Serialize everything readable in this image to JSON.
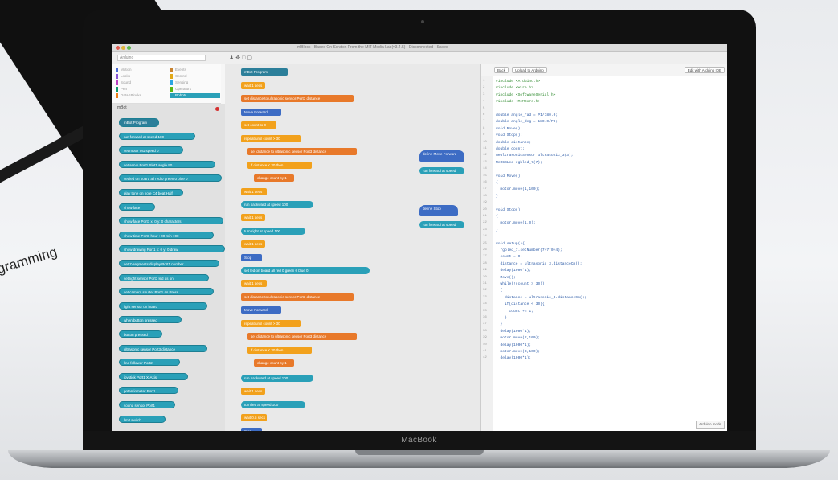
{
  "backdrop": {
    "caption": "gramming"
  },
  "laptop": {
    "brand": "MacBook"
  },
  "window": {
    "title": "mBlock - Based On Scratch From the MIT Media Lab(v3.4.5) - Disconnected - Saved",
    "search_placeholder": "Arduino"
  },
  "categories": [
    {
      "label": "Motion",
      "color": "#4a6cd4"
    },
    {
      "label": "Looks",
      "color": "#8a55d7"
    },
    {
      "label": "Sound",
      "color": "#bb42c3"
    },
    {
      "label": "Pen",
      "color": "#0e9a6c"
    },
    {
      "label": "Data&Blocks",
      "color": "#ee7d16"
    },
    {
      "label": "Events",
      "color": "#c88330"
    },
    {
      "label": "Control",
      "color": "#e1a91a"
    },
    {
      "label": "Sensing",
      "color": "#2ca5e2"
    },
    {
      "label": "Operators",
      "color": "#5cb712"
    },
    {
      "label": "Robots",
      "color": "#2aa0b8"
    }
  ],
  "flyout": {
    "title": "mBot",
    "blocks": [
      "mBot Program",
      "run forward at speed 100",
      "set motor M1 speed 0",
      "set servo Port1 Slot1 angle 90",
      "set led on board all red 0 green 0 blue 0",
      "play tone on note C4 beat Half",
      "show face",
      "show face Port1 x: 0 y: 0 characters",
      "show time Port1 hour : 00 min : 00",
      "show drawing Port1 x: 0 y: 0 draw",
      "set 7-segments display Port1 number",
      "set light sensor Port3 led as on",
      "set camera shutter Port1 as Press",
      "light sensor on board",
      "when button pressed",
      "button pressed",
      "ultrasonic sensor Port3 distance",
      "line follower Port2",
      "joystick Port1 X-Axis",
      "potentiometer Port1",
      "sound sensor Port1",
      "limit switch"
    ]
  },
  "workspace": {
    "blocks": [
      "mBot Program",
      "wait 1 secs",
      "set distance to ultrasonic sensor Port3 distance",
      "Move Forward",
      "set count to 0",
      "repeat until count > 30",
      "set distance to ultrasonic sensor Port3 distance",
      "if distance < 30 then",
      "change count by 1",
      "wait 1 secs",
      "run backward at speed 100",
      "wait 1 secs",
      "turn right at speed 100",
      "wait 1 secs",
      "Stop",
      "set led on board all red 0 green 0 blue 0",
      "wait 1 secs",
      "set distance to ultrasonic sensor Port3 distance",
      "Move Forward",
      "repeat until count > 30",
      "set distance to ultrasonic sensor Port3 distance",
      "if distance < 30 then",
      "change count by 1",
      "run backward at speed 100",
      "wait 1 secs",
      "turn left at speed 100",
      "wait 0.5 secs",
      "Stop"
    ],
    "defs": [
      "define Move Forward",
      "run forward at speed",
      "define Stop",
      "run forward at speed"
    ]
  },
  "code": {
    "back_label": "Back",
    "upload_label": "Upload to Arduino",
    "edit_label": "Edit with Arduino IDE",
    "footer_label": "Arduino mode",
    "lines": [
      "#include <Arduino.h>",
      "#include <Wire.h>",
      "#include <SoftwareSerial.h>",
      "#include <MeMCore.h>",
      "",
      "double angle_rad = PI/180.0;",
      "double angle_deg = 180.0/PI;",
      "void Move();",
      "void Stop();",
      "double distance;",
      "double count;",
      "MeUltrasonicSensor ultrasonic_3(3);",
      "MeRGBLed rgbled_7(7);",
      "",
      "void Move()",
      "{",
      "  motor.move(1,100);",
      "}",
      "",
      "void Stop()",
      "{",
      "  motor.move(1,0);",
      "}",
      "",
      "void setup(){",
      "  rgbled_7.setNumber(7+7*0+4);",
      "  count = 0;",
      "  distance = ultrasonic_3.distanceCm();",
      "  delay(1000*1);",
      "  Move();",
      "  while(!(count > 30))",
      "  {",
      "    distance = ultrasonic_3.distanceCm();",
      "    if(distance < 30){",
      "      count += 1;",
      "    }",
      "  }",
      "  delay(1000*1);",
      "  motor.move(2,100);",
      "  delay(1000*1);",
      "  motor.move(3,100);",
      "  delay(1000*1);"
    ]
  }
}
